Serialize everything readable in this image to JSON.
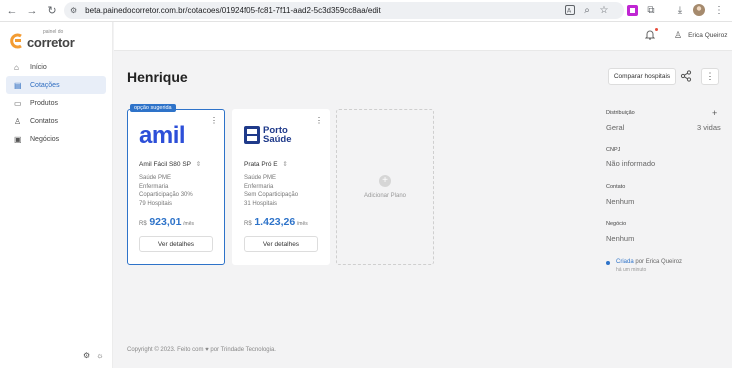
{
  "browser": {
    "url": "beta.painedocorretor.com.br/cotacoes/01924f05-fc81-7f11-aad2-5c3d359cc8aa/edit"
  },
  "brand": {
    "small": "painel do",
    "name": "corretor"
  },
  "sidebar": {
    "items": [
      {
        "label": "Início",
        "icon": "home-icon"
      },
      {
        "label": "Cotações",
        "icon": "quotes-icon"
      },
      {
        "label": "Produtos",
        "icon": "products-icon"
      },
      {
        "label": "Contatos",
        "icon": "contacts-icon"
      },
      {
        "label": "Negócios",
        "icon": "briefcase-icon"
      }
    ]
  },
  "topbar": {
    "user_name": "Erica Queiroz"
  },
  "page": {
    "title": "Henrique",
    "compare_label": "Comparar hospitais"
  },
  "cards": [
    {
      "badge": "opção sugerida",
      "logo": "amil",
      "plan": "Amil Fácil S80 SP",
      "lines": [
        "Saúde PME",
        "Enfermaria",
        "Coparticipação 30%",
        "79 Hospitais"
      ],
      "currency": "R$",
      "price": "923,01",
      "period": "/mês",
      "button": "Ver detalhes"
    },
    {
      "badge": "",
      "logo_line1": "Porto",
      "logo_line2": "Saúde",
      "plan": "Prata Pró E",
      "lines": [
        "Saúde PME",
        "Enfermaria",
        "Sem Coparticipação",
        "31 Hospitais"
      ],
      "currency": "R$",
      "price": "1.423,26",
      "period": "/mês",
      "button": "Ver detalhes"
    }
  ],
  "add_plan": {
    "label": "Adicionar Plano"
  },
  "panel": {
    "distribuicao_label": "Distribuição",
    "geral": "Geral",
    "vidas": "3 vidas",
    "cnpj_label": "CNPJ",
    "cnpj_value": "Não informado",
    "contato_label": "Contato",
    "contato_value": "Nenhum",
    "negocio_label": "Negócio",
    "negocio_value": "Nenhum",
    "activity_action": "Criada",
    "activity_by": "por Erica Queiroz",
    "activity_time": "há um minuto"
  },
  "footer": {
    "text": "Copyright © 2023. Feito com ♥ por Trindade Tecnologia."
  },
  "colors": {
    "accent": "#2e73c9",
    "brand_orange": "#f39c33",
    "amil_blue": "#2d4fd8",
    "porto_blue": "#1f3a8a"
  }
}
